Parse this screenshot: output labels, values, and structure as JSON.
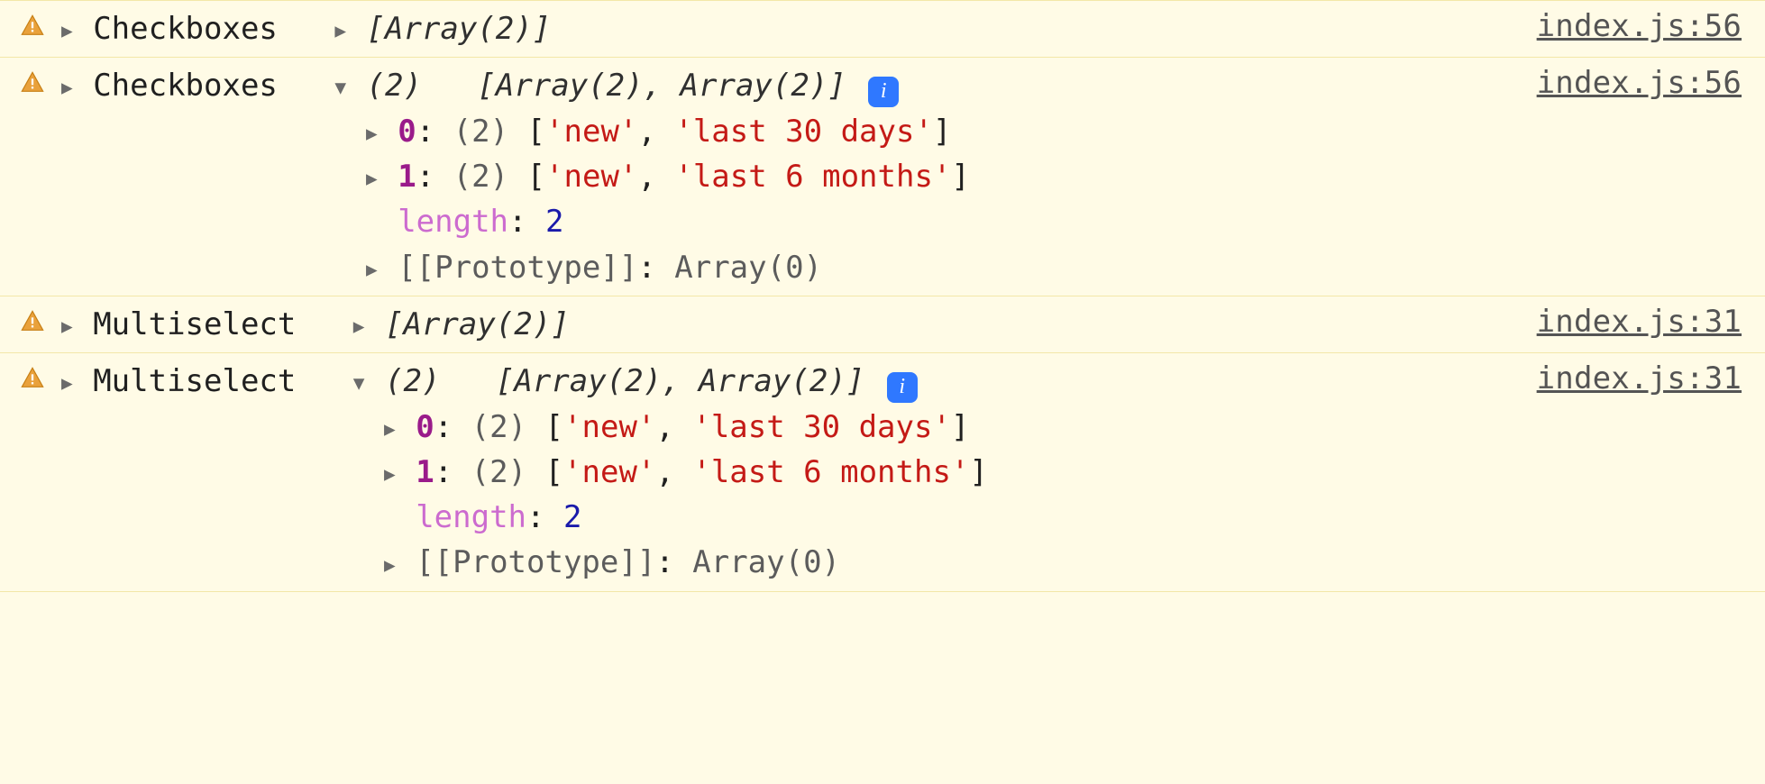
{
  "icons": {
    "info_glyph": "i",
    "tri_right": "▶",
    "tri_down": "▼"
  },
  "rows": [
    {
      "id": "r0",
      "source": "index.js:56",
      "label": "Checkboxes",
      "expanded": false,
      "summary_collapsed": "[Array(2)]"
    },
    {
      "id": "r1",
      "source": "index.js:56",
      "label": "Checkboxes",
      "expanded": true,
      "summary_count": "(2)",
      "summary_body": "[Array(2), Array(2)]",
      "has_info": true,
      "children": {
        "entries": [
          {
            "index": "0",
            "count": "(2)",
            "open": "[",
            "a": "'new'",
            "sep": ", ",
            "b": "'last 30 days'",
            "close": "]"
          },
          {
            "index": "1",
            "count": "(2)",
            "open": "[",
            "a": "'new'",
            "sep": ", ",
            "b": "'last 6 months'",
            "close": "]"
          }
        ],
        "length_key": "length",
        "length_colon": ": ",
        "length_val": "2",
        "proto_key": "[[Prototype]]",
        "proto_colon": ": ",
        "proto_val": "Array(0)"
      }
    },
    {
      "id": "r2",
      "source": "index.js:31",
      "label": "Multiselect",
      "expanded": false,
      "summary_collapsed": "[Array(2)]"
    },
    {
      "id": "r3",
      "source": "index.js:31",
      "label": "Multiselect",
      "expanded": true,
      "summary_count": "(2)",
      "summary_body": "[Array(2), Array(2)]",
      "has_info": true,
      "children": {
        "entries": [
          {
            "index": "0",
            "count": "(2)",
            "open": "[",
            "a": "'new'",
            "sep": ", ",
            "b": "'last 30 days'",
            "close": "]"
          },
          {
            "index": "1",
            "count": "(2)",
            "open": "[",
            "a": "'new'",
            "sep": ", ",
            "b": "'last 6 months'",
            "close": "]"
          }
        ],
        "length_key": "length",
        "length_colon": ": ",
        "length_val": "2",
        "proto_key": "[[Prototype]]",
        "proto_colon": ": ",
        "proto_val": "Array(0)"
      }
    }
  ]
}
